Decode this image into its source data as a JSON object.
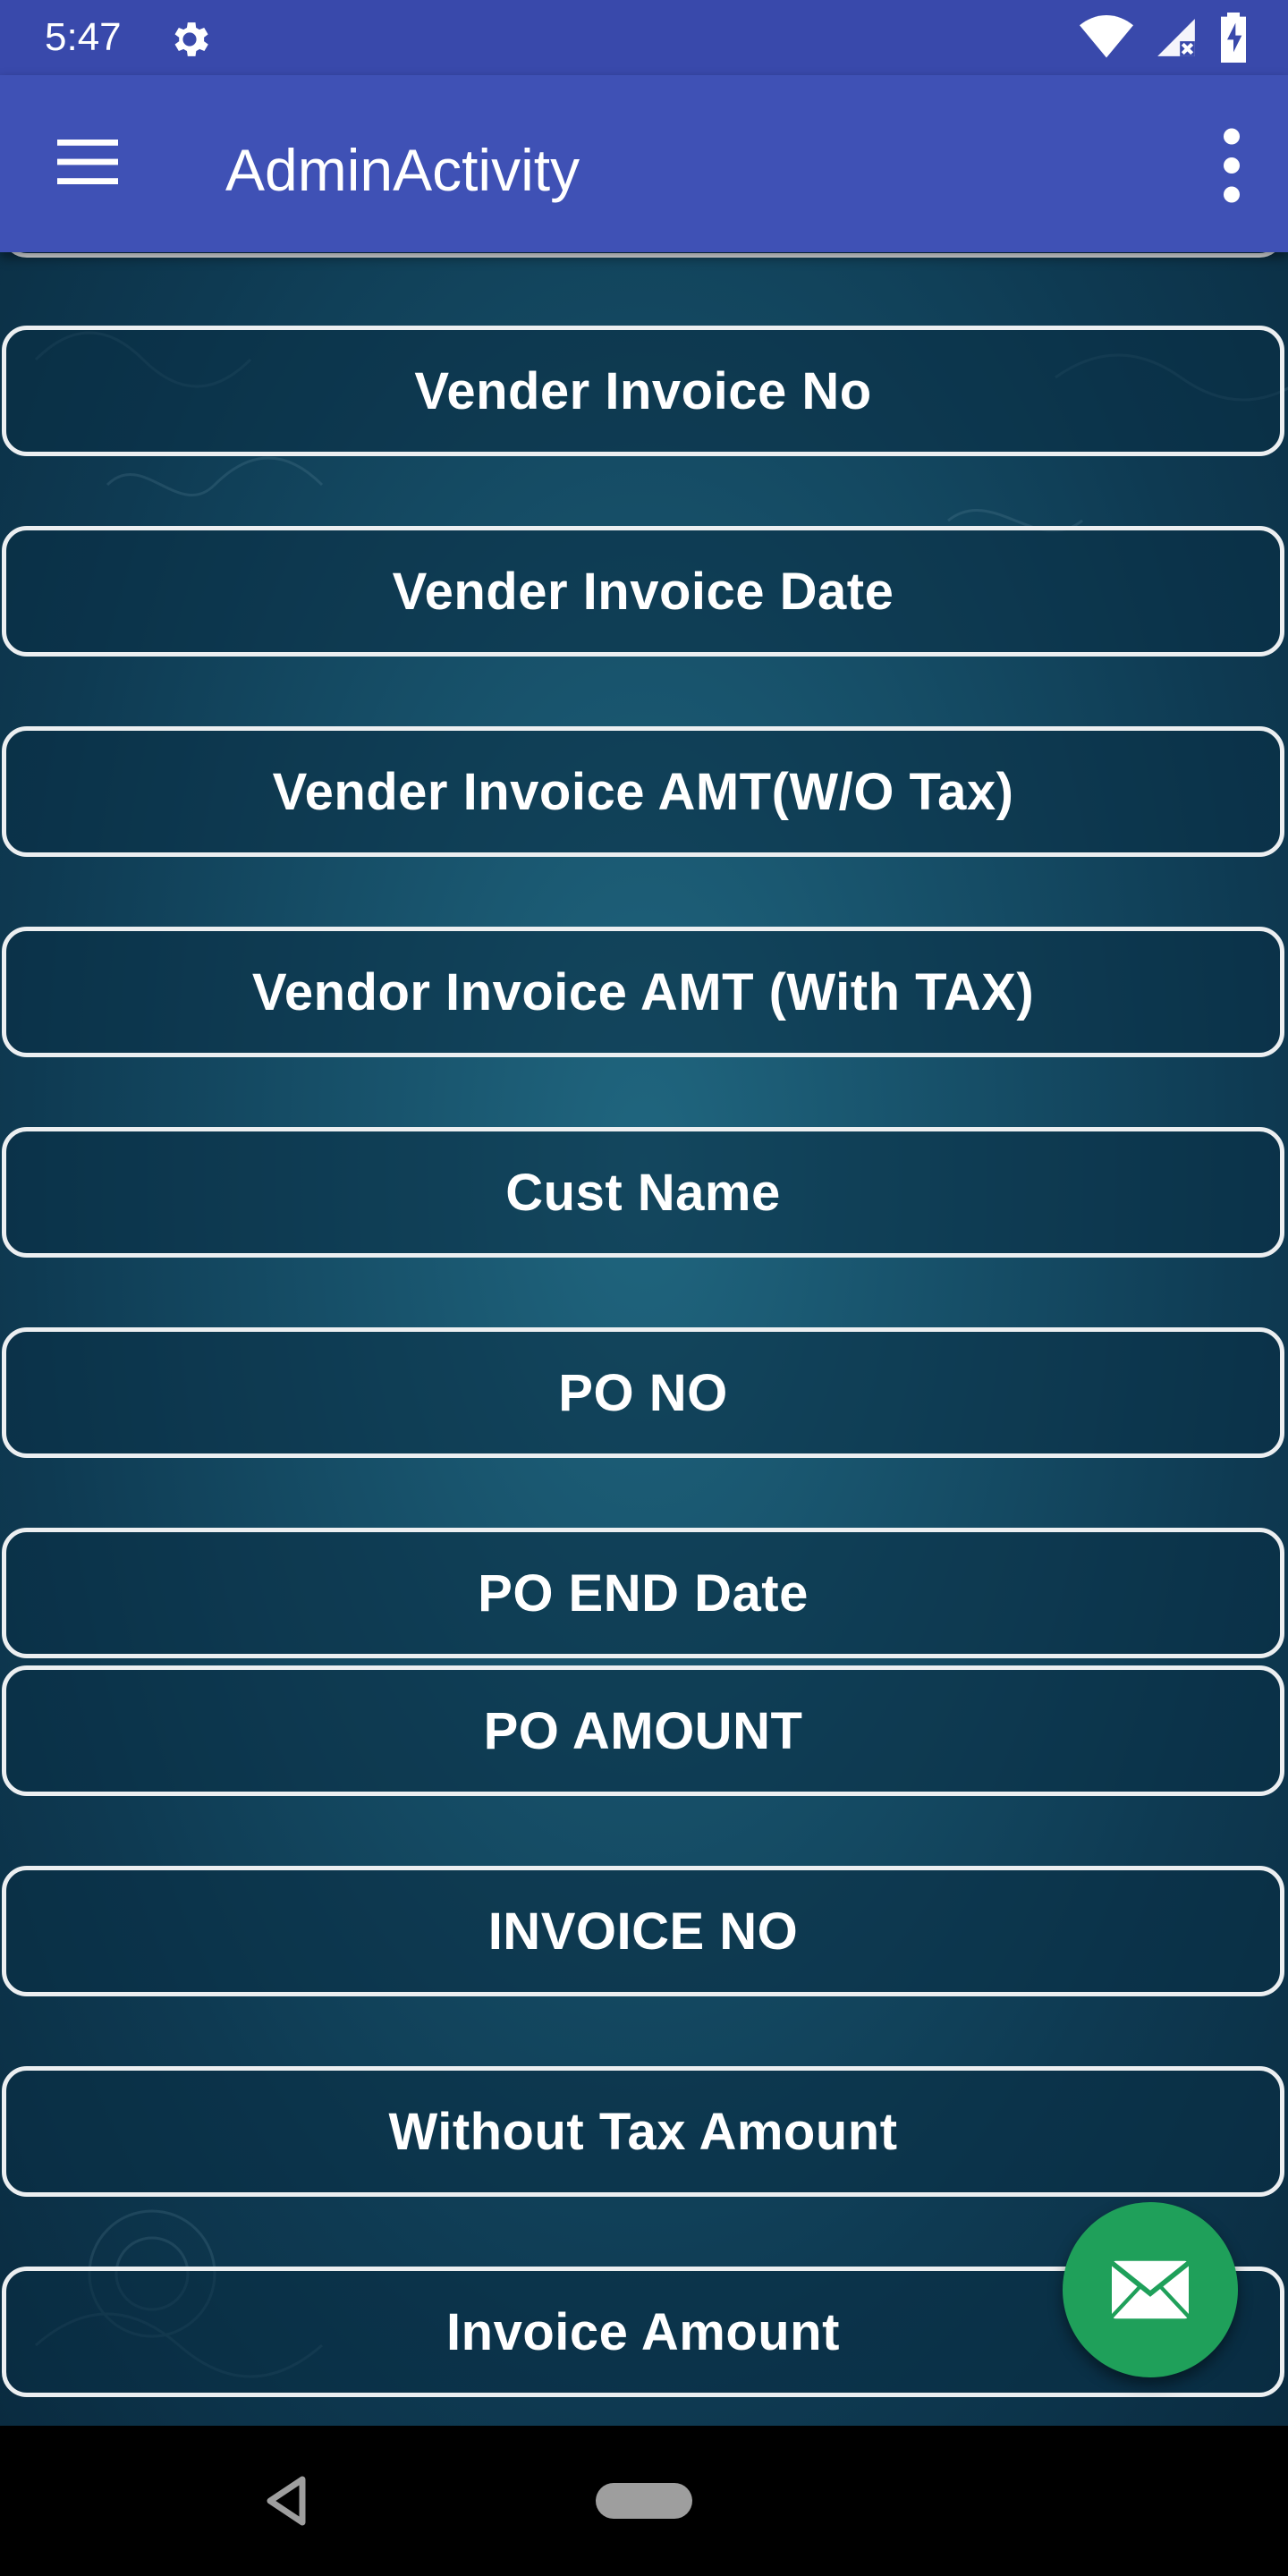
{
  "status_bar": {
    "time": "5:47",
    "icons": [
      "settings-icon",
      "wifi-icon",
      "signal-icon",
      "battery-charging-icon"
    ]
  },
  "app_bar": {
    "title": "AdminActivity",
    "menu_icon": "hamburger-menu-icon",
    "overflow_icon": "more-vertical-icon"
  },
  "fields": [
    {
      "label": "Vender Invoice No"
    },
    {
      "label": "Vender Invoice Date"
    },
    {
      "label": "Vender Invoice AMT(W/O Tax)"
    },
    {
      "label": "Vendor Invoice AMT (With TAX)"
    },
    {
      "label": "Cust Name"
    },
    {
      "label": "PO NO"
    },
    {
      "label": "PO END Date"
    },
    {
      "label": "PO AMOUNT"
    },
    {
      "label": "INVOICE NO"
    },
    {
      "label": "Without Tax Amount"
    },
    {
      "label": "Invoice Amount"
    }
  ],
  "fab": {
    "icon": "mail-icon"
  },
  "nav_bar": {
    "icons": [
      "back-icon",
      "home-pill-icon"
    ]
  },
  "colors": {
    "status_bar": "#3949ab",
    "app_bar": "#3f51b5",
    "fab": "#1fa05a",
    "button_border": "#eceff1"
  }
}
